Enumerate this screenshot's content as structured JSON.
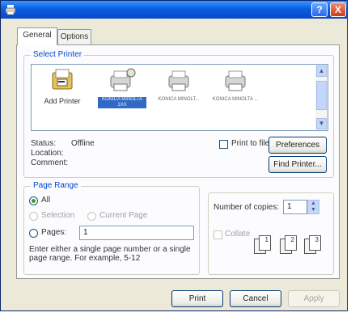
{
  "title_bar": {
    "icon": "printer-app-icon",
    "help_label": "?",
    "close_label": "X"
  },
  "tabs": [
    {
      "label": "General"
    },
    {
      "label": "Options"
    }
  ],
  "select_printer": {
    "legend": "Select Printer",
    "printers": [
      {
        "label": "Add Printer",
        "icon": "add-printer-icon"
      },
      {
        "label": "KONICA MINOLTA 1XX",
        "icon": "network-printer-icon",
        "selected": true
      },
      {
        "label": "KONICA MINOLT...",
        "icon": "printer-icon"
      },
      {
        "label": "KONICA MINOLTA ...",
        "icon": "printer-icon"
      }
    ],
    "status_label": "Status:",
    "status_value": "Offline",
    "location_label": "Location:",
    "comment_label": "Comment:",
    "print_to_file_label": "Print to file",
    "preferences_label": "Preferences",
    "find_printer_label": "Find Printer..."
  },
  "page_range": {
    "legend": "Page Range",
    "all_label": "All",
    "selection_label": "Selection",
    "current_page_label": "Current Page",
    "pages_label": "Pages:",
    "pages_value": "1",
    "hint_line1": "Enter either a single page number or a single",
    "hint_line2": "page range.  For example, 5-12"
  },
  "copies": {
    "label": "Number of copies:",
    "value": "1",
    "collate_label": "Collate",
    "collate_pages": [
      "1",
      "2",
      "3"
    ]
  },
  "buttons": {
    "print_label": "Print",
    "cancel_label": "Cancel",
    "apply_label": "Apply"
  },
  "colors": {
    "title_bar": "#0a5fe0",
    "selection": "#316ac5",
    "group_legend": "#0046d5"
  }
}
